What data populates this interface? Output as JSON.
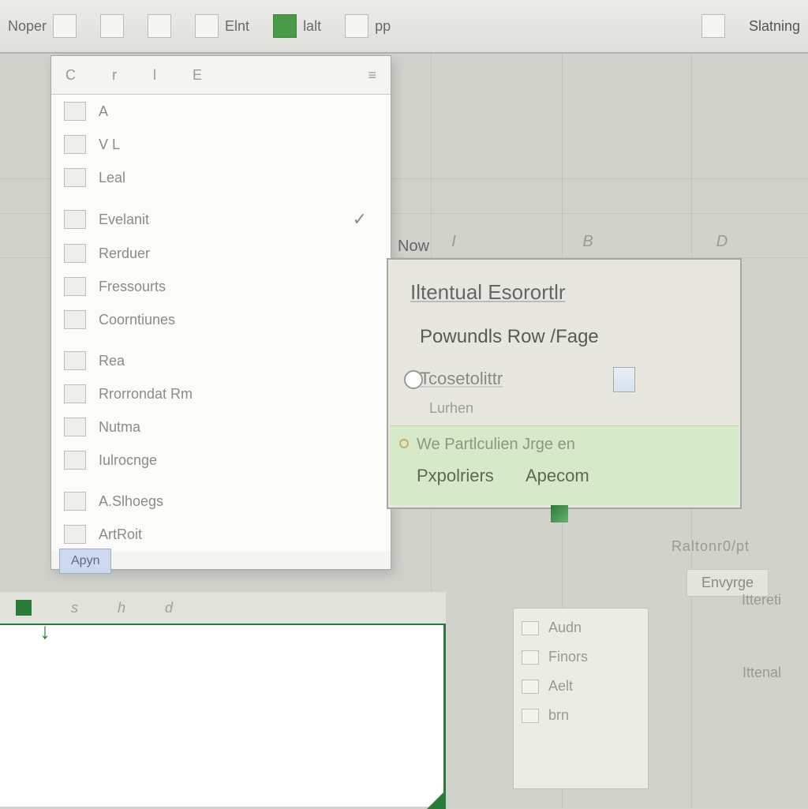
{
  "ribbon": {
    "groups": [
      {
        "label": "Noper"
      },
      {
        "label": ""
      },
      {
        "label": ""
      },
      {
        "label": ""
      },
      {
        "label": "Elnt"
      },
      {
        "label": "lalt"
      },
      {
        "label": "pp"
      },
      {
        "label": ""
      },
      {
        "label": "Slatning"
      }
    ]
  },
  "dropdown": {
    "topbar": [
      "C",
      "r",
      "l",
      "E",
      "≡"
    ],
    "items": [
      {
        "label": "A",
        "checked": false
      },
      {
        "label": "V L",
        "checked": false
      },
      {
        "label": "Leal",
        "checked": false
      },
      {
        "label": "Evelanit",
        "checked": true
      },
      {
        "label": "Rerduer",
        "checked": false
      },
      {
        "label": "Fressourts",
        "checked": false
      },
      {
        "label": "Coorntiunes",
        "checked": false
      },
      {
        "label": "Rea",
        "checked": false
      },
      {
        "label": "Rrorrondat Rm",
        "checked": false
      },
      {
        "label": "Nutma",
        "checked": false
      },
      {
        "label": "Iulrocnge",
        "checked": false
      },
      {
        "label": "A.Slhoegs",
        "checked": false
      },
      {
        "label": "ArtRoit",
        "checked": false
      }
    ],
    "footer": "Apyn"
  },
  "cols": [
    "I",
    "B",
    "D"
  ],
  "tooltip": {
    "now": "Now",
    "title": "Iltentual Esorortlr",
    "sub": "Powundls Row /Fage",
    "opt": "Tcosetolittr",
    "line4": "Lurhen",
    "hl_l1": "We Partlculien Jrge en",
    "hl_l2a": "Pxpolriers",
    "hl_l2b": "Apecom"
  },
  "side": {
    "hdr": "Raltonr0/pt",
    "tab": "Envyrge",
    "r1": "Ittereti",
    "r2": "Ittenal",
    "list": [
      "Audn",
      "Finors",
      "Aelt",
      "brn"
    ]
  },
  "sheet": {
    "cols": [
      "s",
      "h",
      "d"
    ]
  }
}
